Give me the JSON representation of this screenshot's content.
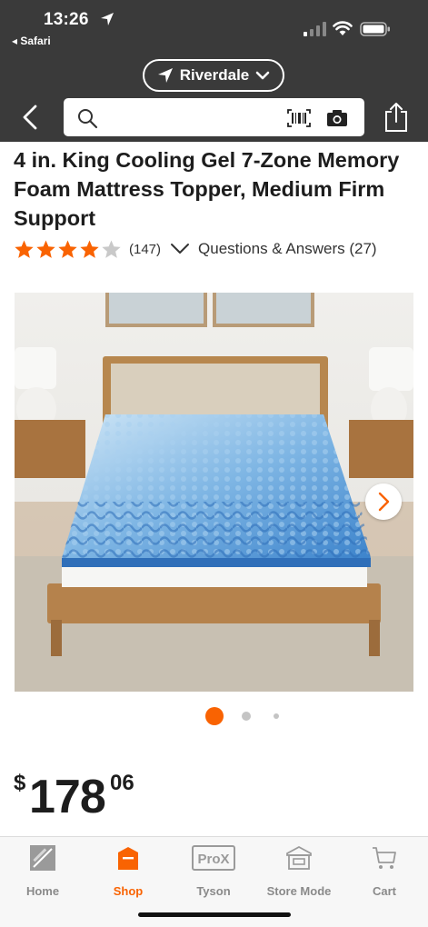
{
  "status_bar": {
    "time": "13:26",
    "back_app": "◂ Safari"
  },
  "header": {
    "location": "Riverdale",
    "search_placeholder": "",
    "accent_color": "#f96302"
  },
  "product": {
    "title": "4 in. King Cooling Gel 7-Zone Memory Foam Mattress Topper, Medium Firm Support",
    "rating": 4,
    "rating_max": 5,
    "review_count": "(147)",
    "qa_label": "Questions & Answers (27)"
  },
  "gallery": {
    "image_icon": "mattress-topper-photo",
    "current_index": 0,
    "dot_count": 3
  },
  "price": {
    "currency": "$",
    "dollars": "178",
    "cents": "06"
  },
  "tabbar": {
    "tabs": [
      {
        "label": "Home",
        "icon": "home-depot-logo-icon",
        "active": false
      },
      {
        "label": "Shop",
        "icon": "shop-icon",
        "active": true
      },
      {
        "label": "Tyson",
        "icon": "prox-icon",
        "active": false
      },
      {
        "label": "Store Mode",
        "icon": "store-icon",
        "active": false
      },
      {
        "label": "Cart",
        "icon": "cart-icon",
        "active": false
      }
    ]
  }
}
